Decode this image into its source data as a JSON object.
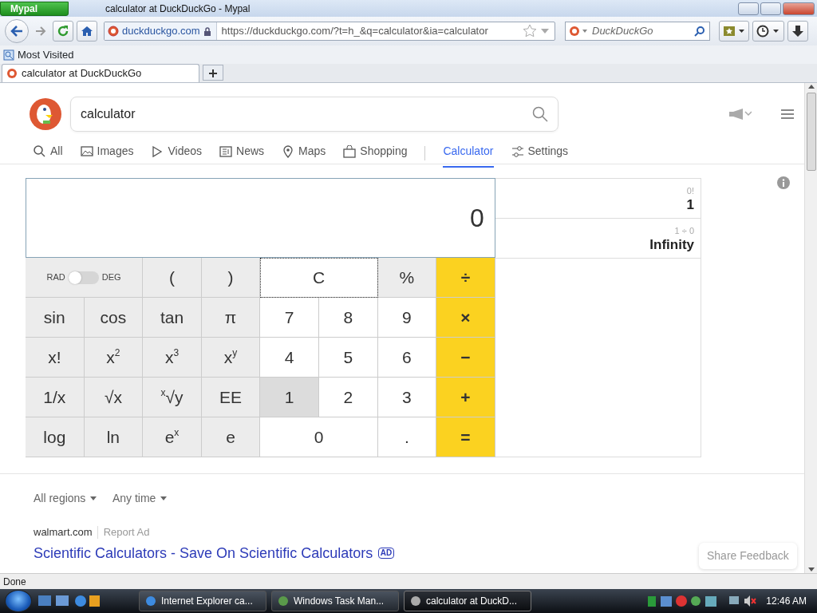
{
  "window": {
    "app_button": "Mypal",
    "title": "calculator at DuckDuckGo - Mypal"
  },
  "toolbar": {
    "site_identity": "duckduckgo.com",
    "address": "https://duckduckgo.com/?t=h_&q=calculator&ia=calculator",
    "search_placeholder": "DuckDuckGo"
  },
  "bookmarks": [
    "Most Visited"
  ],
  "tabs": [
    {
      "label": "calculator at DuckDuckGo",
      "selected": true
    }
  ],
  "page": {
    "search_value": "calculator",
    "nav": [
      {
        "label": "All",
        "selected": false
      },
      {
        "label": "Images",
        "selected": false
      },
      {
        "label": "Videos",
        "selected": false
      },
      {
        "label": "News",
        "selected": false
      },
      {
        "label": "Maps",
        "selected": false
      },
      {
        "label": "Shopping",
        "selected": false
      },
      {
        "label": "Calculator",
        "selected": true
      },
      {
        "label": "Settings",
        "selected": false
      }
    ],
    "calculator": {
      "display": "0",
      "history": [
        {
          "expression": "0!",
          "result": "1"
        },
        {
          "expression": "1 ÷ 0",
          "result": "Infinity"
        }
      ],
      "keys": [
        {
          "kind": "toggle",
          "left": "RAD",
          "right": "DEG",
          "on": false,
          "hovered": false,
          "focused": false
        },
        {
          "kind": "function",
          "label": "(",
          "hovered": false,
          "focused": false
        },
        {
          "kind": "function",
          "label": ")",
          "hovered": false,
          "focused": false
        },
        {
          "kind": "clear",
          "label": "C",
          "hovered": false,
          "focused": true
        },
        {
          "kind": "function",
          "label": "%",
          "hovered": false,
          "focused": false
        },
        {
          "kind": "operator",
          "label": "÷",
          "hovered": false,
          "focused": false
        },
        {
          "kind": "function",
          "label": "sin",
          "hovered": false,
          "focused": false
        },
        {
          "kind": "function",
          "label": "cos",
          "hovered": false,
          "focused": false
        },
        {
          "kind": "function",
          "label": "tan",
          "hovered": false,
          "focused": false
        },
        {
          "kind": "function",
          "label": "π",
          "hovered": false,
          "focused": false
        },
        {
          "kind": "digit",
          "label": "7",
          "hovered": false,
          "focused": false
        },
        {
          "kind": "digit",
          "label": "8",
          "hovered": false,
          "focused": false
        },
        {
          "kind": "digit",
          "label": "9",
          "hovered": false,
          "focused": false
        },
        {
          "kind": "operator",
          "label": "×",
          "hovered": false,
          "focused": false
        },
        {
          "kind": "function",
          "label": "x!",
          "hovered": false,
          "focused": false
        },
        {
          "kind": "function",
          "label": "x$^{2}$",
          "hovered": false,
          "focused": false
        },
        {
          "kind": "function",
          "label": "x$^{3}$",
          "hovered": false,
          "focused": false
        },
        {
          "kind": "function",
          "label": "x$^{y}$",
          "hovered": false,
          "focused": false
        },
        {
          "kind": "digit",
          "label": "4",
          "hovered": false,
          "focused": false
        },
        {
          "kind": "digit",
          "label": "5",
          "hovered": false,
          "focused": false
        },
        {
          "kind": "digit",
          "label": "6",
          "hovered": false,
          "focused": false
        },
        {
          "kind": "operator",
          "label": "−",
          "hovered": false,
          "focused": false
        },
        {
          "kind": "function",
          "label": "1/x",
          "hovered": false,
          "focused": false
        },
        {
          "kind": "function",
          "label": "√x",
          "hovered": false,
          "focused": false
        },
        {
          "kind": "function",
          "label": "$^{x}$√y",
          "hovered": false,
          "focused": false
        },
        {
          "kind": "function",
          "label": "EE",
          "hovered": false,
          "focused": false
        },
        {
          "kind": "digit",
          "label": "1",
          "hovered": true,
          "focused": false
        },
        {
          "kind": "digit",
          "label": "2",
          "hovered": false,
          "focused": false
        },
        {
          "kind": "digit",
          "label": "3",
          "hovered": false,
          "focused": false
        },
        {
          "kind": "operator",
          "label": "+",
          "hovered": false,
          "focused": false
        },
        {
          "kind": "function",
          "label": "log",
          "hovered": false,
          "focused": false
        },
        {
          "kind": "function",
          "label": "ln",
          "hovered": false,
          "focused": false
        },
        {
          "kind": "function",
          "label": "e$^{x}$",
          "hovered": false,
          "focused": false
        },
        {
          "kind": "function",
          "label": "e",
          "hovered": false,
          "focused": false
        },
        {
          "kind": "zero",
          "label": "0",
          "hovered": false,
          "focused": false
        },
        {
          "kind": "digit",
          "label": ".",
          "hovered": false,
          "focused": false
        },
        {
          "kind": "operator",
          "label": "=",
          "hovered": false,
          "focused": false
        }
      ]
    },
    "filters": [
      "All regions",
      "Any time"
    ],
    "ad": {
      "domain": "walmart.com",
      "report": "Report Ad",
      "title": "Scientific Calculators - Save On Scientific Calculators",
      "badge": "AD"
    },
    "feedback_button": "Share Feedback"
  },
  "status_bar": "Done",
  "taskbar": {
    "items": [
      {
        "label": "Internet Explorer ca...",
        "selected": false
      },
      {
        "label": "Windows Task Man...",
        "selected": false
      },
      {
        "label": "calculator at DuckD...",
        "selected": true
      }
    ],
    "clock": "12:46 AM"
  }
}
